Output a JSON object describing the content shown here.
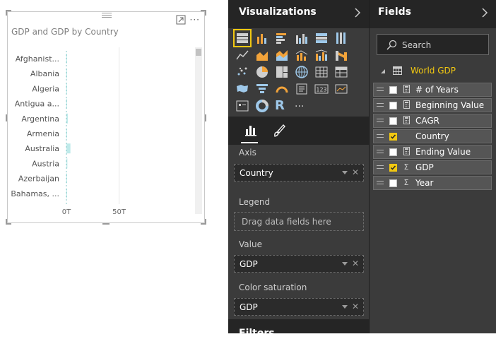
{
  "visual": {
    "title": "GDP and GDP by Country",
    "more_label": "···"
  },
  "chart_data": {
    "type": "bar",
    "orientation": "horizontal",
    "categories": [
      "Afghanist...",
      "Albania",
      "Algeria",
      "Antigua a...",
      "Argentina",
      "Armenia",
      "Australia",
      "Austria",
      "Azerbaijan",
      "Bahamas, ..."
    ],
    "values": [
      0.5,
      0.05,
      0.4,
      0.02,
      1.3,
      0.03,
      3.8,
      0.9,
      0.2,
      0.03
    ],
    "x_ticks": [
      "0T",
      "50T"
    ],
    "xlim": [
      0,
      120
    ],
    "title": "GDP and GDP by Country",
    "bar_color": "#bfeaea",
    "grid": true
  },
  "visualizations_pane": {
    "title": "Visualizations",
    "icons": [
      "stacked-bar-icon",
      "stacked-column-icon",
      "clustered-bar-icon",
      "clustered-column-icon",
      "100-stacked-bar-icon",
      "100-stacked-column-icon",
      "line-chart-icon",
      "area-chart-icon",
      "stacked-area-icon",
      "line-column-icon",
      "line-clustered-column-icon",
      "ribbon-chart-icon",
      "scatter-chart-icon",
      "pie-chart-icon",
      "treemap-icon",
      "map-icon",
      "table-icon",
      "matrix-icon",
      "filled-map-icon",
      "funnel-icon",
      "gauge-icon",
      "multi-row-card-icon",
      "card-icon",
      "kpi-icon",
      "slicer-icon",
      "donut-chart-icon",
      "r-visual-icon",
      "more-visuals-icon"
    ],
    "more_icon_label": "···",
    "r_label": "R",
    "card_label": "123",
    "sections": {
      "axis": {
        "label": "Axis",
        "value": "Country"
      },
      "legend": {
        "label": "Legend",
        "placeholder": "Drag data fields here"
      },
      "value": {
        "label": "Value",
        "value": "GDP"
      },
      "color_saturation": {
        "label": "Color saturation",
        "value": "GDP"
      }
    },
    "remove_glyph": "✕",
    "filters_label": "Filters"
  },
  "fields_pane": {
    "title": "Fields",
    "search_placeholder": "Search",
    "table_name": "World GDP",
    "fields": [
      {
        "name": "# of Years",
        "checked": false,
        "type": "calc"
      },
      {
        "name": "Beginning Value",
        "checked": false,
        "type": "calc"
      },
      {
        "name": "CAGR",
        "checked": false,
        "type": "calc"
      },
      {
        "name": "Country",
        "checked": true,
        "type": "text"
      },
      {
        "name": "Ending Value",
        "checked": false,
        "type": "calc"
      },
      {
        "name": "GDP",
        "checked": true,
        "type": "sum"
      },
      {
        "name": "Year",
        "checked": false,
        "type": "sum"
      }
    ],
    "sum_symbol": "Σ"
  },
  "colors": {
    "accent": "#f2c811",
    "pane_bg": "#3b3b3b",
    "header_bg": "#252525"
  }
}
